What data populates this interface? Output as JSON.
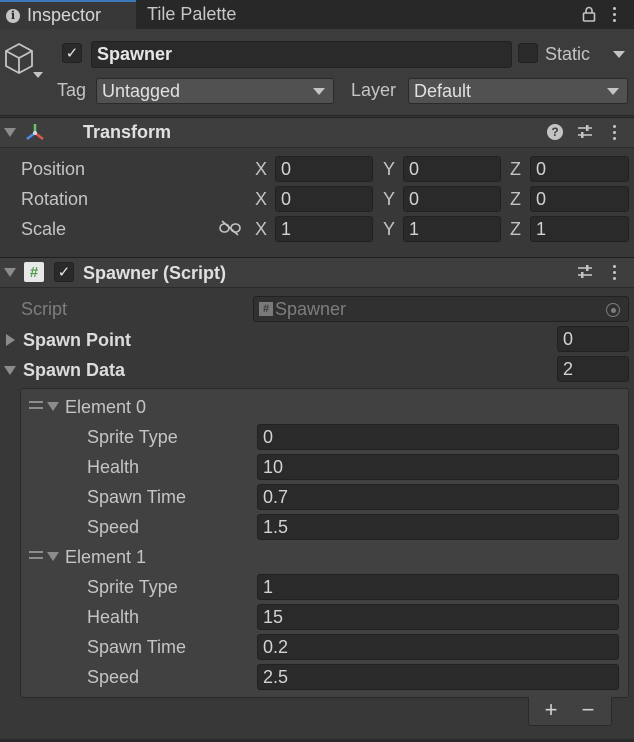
{
  "tabs": [
    {
      "label": "Inspector",
      "icon": "info-icon",
      "active": true
    },
    {
      "label": "Tile Palette",
      "active": false
    }
  ],
  "gameobject": {
    "name": "Spawner",
    "active": true,
    "static_label": "Static",
    "static_checked": false,
    "tag_label": "Tag",
    "tag_value": "Untagged",
    "layer_label": "Layer",
    "layer_value": "Default"
  },
  "transform": {
    "title": "Transform",
    "rows": [
      {
        "label": "Position",
        "x": "0",
        "y": "0",
        "z": "0"
      },
      {
        "label": "Rotation",
        "x": "0",
        "y": "0",
        "z": "0"
      },
      {
        "label": "Scale",
        "x": "1",
        "y": "1",
        "z": "1"
      }
    ],
    "axis_labels": [
      "X",
      "Y",
      "Z"
    ]
  },
  "script_component": {
    "title": "Spawner (Script)",
    "enabled": true,
    "script_label": "Script",
    "script_value": "Spawner",
    "spawn_point_label": "Spawn Point",
    "spawn_point_value": "0",
    "spawn_data_label": "Spawn Data",
    "spawn_data_count": "2",
    "elements": [
      {
        "label": "Element 0",
        "fields": [
          {
            "label": "Sprite Type",
            "value": "0"
          },
          {
            "label": "Health",
            "value": "10"
          },
          {
            "label": "Spawn Time",
            "value": "0.7"
          },
          {
            "label": "Speed",
            "value": "1.5"
          }
        ]
      },
      {
        "label": "Element 1",
        "fields": [
          {
            "label": "Sprite Type",
            "value": "1"
          },
          {
            "label": "Health",
            "value": "15"
          },
          {
            "label": "Spawn Time",
            "value": "0.2"
          },
          {
            "label": "Speed",
            "value": "2.5"
          }
        ]
      }
    ],
    "add_label": "+",
    "remove_label": "−"
  },
  "colors": {
    "background": "#383838",
    "field": "#2a2a2a",
    "accent": "#3a79bb",
    "script_icon": "#5fb35f"
  }
}
